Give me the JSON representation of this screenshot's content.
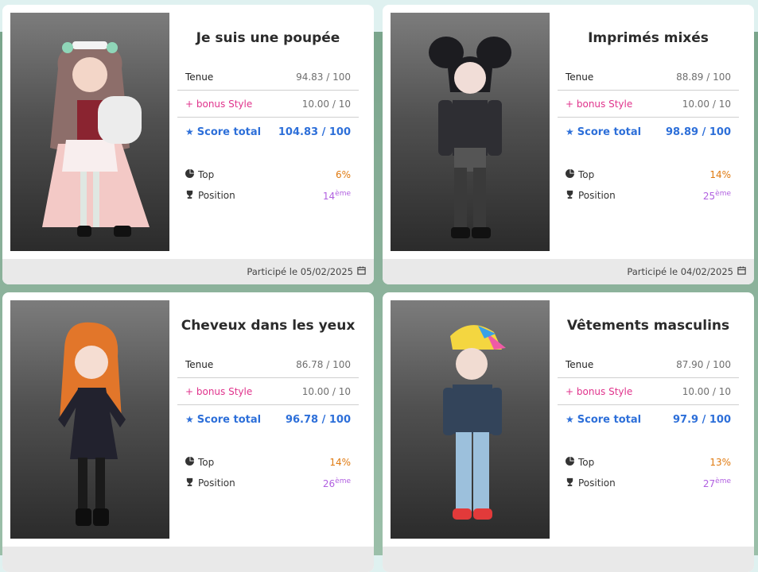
{
  "cards": [
    {
      "title": "Je suis une poupée",
      "tenue_label": "Tenue",
      "tenue_value": "94.83 / 100",
      "bonus_label": "+ bonus Style",
      "bonus_value": "10.00 / 10",
      "total_label": "Score total",
      "total_value": "104.83 / 100",
      "top_label": "Top",
      "top_value": "6%",
      "position_label": "Position",
      "position_value": "14",
      "position_suffix": "ème",
      "footer": "Participé le 05/02/2025"
    },
    {
      "title": "Imprimés mixés",
      "tenue_label": "Tenue",
      "tenue_value": "88.89 / 100",
      "bonus_label": "+ bonus Style",
      "bonus_value": "10.00 / 10",
      "total_label": "Score total",
      "total_value": "98.89 / 100",
      "top_label": "Top",
      "top_value": "14%",
      "position_label": "Position",
      "position_value": "25",
      "position_suffix": "ème",
      "footer": "Participé le 04/02/2025"
    },
    {
      "title": "Cheveux dans les yeux",
      "tenue_label": "Tenue",
      "tenue_value": "86.78 / 100",
      "bonus_label": "+ bonus Style",
      "bonus_value": "10.00 / 10",
      "total_label": "Score total",
      "total_value": "96.78 / 100",
      "top_label": "Top",
      "top_value": "14%",
      "position_label": "Position",
      "position_value": "26",
      "position_suffix": "ème"
    },
    {
      "title": "Vêtements masculins",
      "tenue_label": "Tenue",
      "tenue_value": "87.90 / 100",
      "bonus_label": "+ bonus Style",
      "bonus_value": "10.00 / 10",
      "total_label": "Score total",
      "total_value": "97.9 / 100",
      "top_label": "Top",
      "top_value": "13%",
      "position_label": "Position",
      "position_value": "27",
      "position_suffix": "ème"
    }
  ],
  "icons": {
    "star": "star-icon",
    "top": "pie-chart-icon",
    "position": "trophy-icon",
    "date": "calendar-icon"
  },
  "colors": {
    "bonus": "#e0338c",
    "total": "#2d6fd9",
    "top": "#e07a10",
    "position": "#b160e0"
  }
}
